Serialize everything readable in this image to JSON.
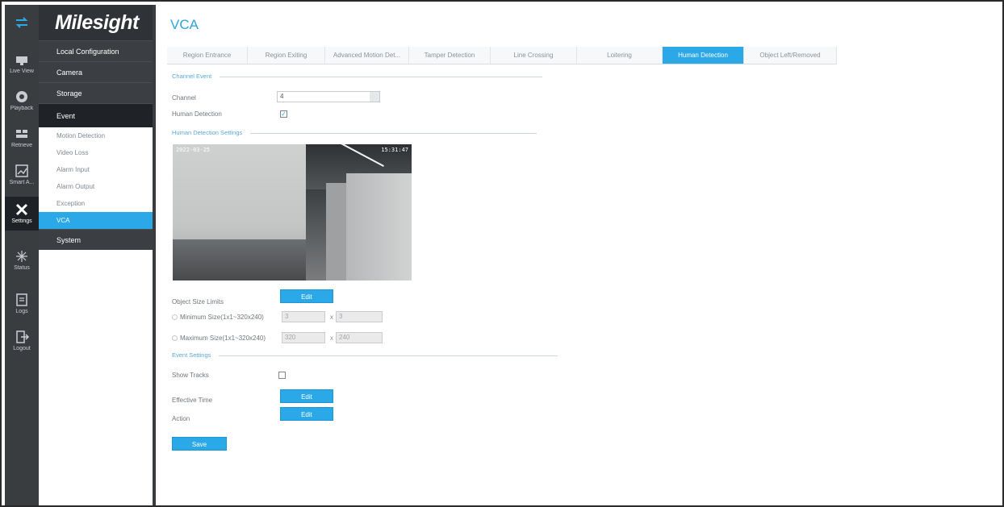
{
  "rail": [
    {
      "icon": "transfer-icon",
      "label": ""
    },
    {
      "icon": "live-view-icon",
      "label": "Live View"
    },
    {
      "icon": "playback-icon",
      "label": "Playback"
    },
    {
      "icon": "retrieve-icon",
      "label": "Retrieve"
    },
    {
      "icon": "smart-analytics-icon",
      "label": "Smart A..."
    },
    {
      "icon": "settings-icon",
      "label": "Settings"
    },
    {
      "icon": "status-icon",
      "label": "Status"
    },
    {
      "icon": "logs-icon",
      "label": "Logs"
    },
    {
      "icon": "logout-icon",
      "label": "Logout"
    }
  ],
  "brand": "Milesight",
  "menu": {
    "local_configuration": "Local Configuration",
    "camera": "Camera",
    "storage": "Storage",
    "event": "Event",
    "event_items": [
      "Motion Detection",
      "Video Loss",
      "Alarm Input",
      "Alarm Output",
      "Exception",
      "VCA"
    ],
    "system": "System"
  },
  "page": {
    "title": "VCA",
    "tabs": [
      "Region Entrance",
      "Region Exiting",
      "Advanced Motion Det...",
      "Tamper Detection",
      "Line Crossing",
      "Loitering",
      "Human Detection",
      "Object Left/Removed"
    ],
    "active_tab": "Human Detection"
  },
  "channel_event": {
    "section": "Channel Event",
    "channel_label": "Channel",
    "channel_value": "4",
    "human_detection_label": "Human Detection",
    "human_detection_checked": true
  },
  "human_detection_settings": {
    "section": "Human Detection Settings",
    "osd_left": "2022-03-25",
    "osd_right": "15:31:47",
    "object_size_limits_label": "Object Size Limits",
    "edit_label": "Edit",
    "min_label": "Minimum Size(1x1~320x240)",
    "min_w": "3",
    "min_h": "3",
    "max_label": "Maximum Size(1x1~320x240)",
    "max_w": "320",
    "max_h": "240",
    "times": "x"
  },
  "event_settings": {
    "section": "Event Settings",
    "show_tracks_label": "Show Tracks",
    "effective_time_label": "Effective Time",
    "action_label": "Action",
    "edit_label": "Edit",
    "save_label": "Save"
  },
  "colors": {
    "accent": "#2aa8e8",
    "rail": "#3a3d40",
    "menu_dark": "#1f2226"
  }
}
